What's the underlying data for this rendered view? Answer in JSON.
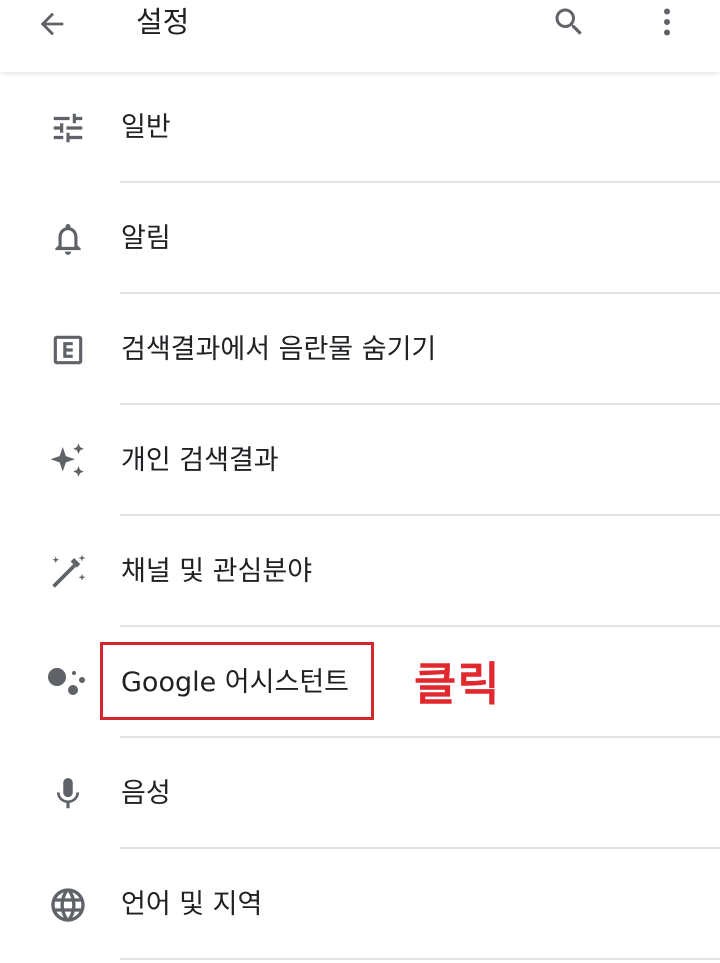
{
  "appbar": {
    "title": "설정",
    "back_icon": "arrow-back-icon",
    "search_icon": "search-icon",
    "more_icon": "more-vert-icon"
  },
  "settings": [
    {
      "label": "일반",
      "icon": "tune-icon"
    },
    {
      "label": "알림",
      "icon": "bell-icon"
    },
    {
      "label": "검색결과에서 음란물 숨기기",
      "icon": "explicit-icon"
    },
    {
      "label": "개인 검색결과",
      "icon": "sparkle-icon"
    },
    {
      "label": "채널 및 관심분야",
      "icon": "magic-wand-icon"
    },
    {
      "label": "Google 어시스턴트",
      "icon": "assistant-icon"
    },
    {
      "label": "음성",
      "icon": "mic-icon"
    },
    {
      "label": "언어 및 지역",
      "icon": "globe-icon"
    }
  ],
  "annotation": {
    "text": "클릭",
    "color": "#e0282e"
  },
  "colors": {
    "icon": "#5f6368",
    "text": "#202124",
    "divider": "#e2e2e2",
    "highlight": "#d6262d"
  }
}
